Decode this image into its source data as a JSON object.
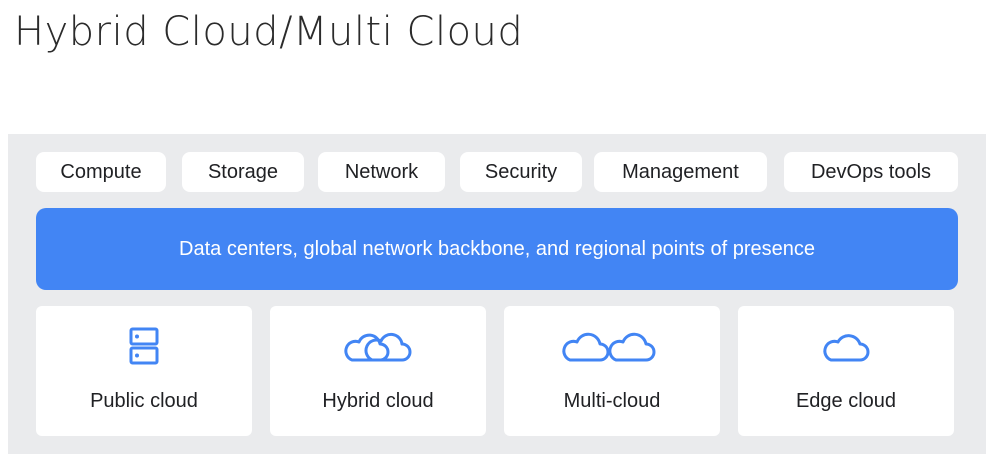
{
  "page": {
    "title": "Hybrid Cloud/Multi Cloud"
  },
  "services": [
    {
      "label": "Compute"
    },
    {
      "label": "Storage"
    },
    {
      "label": "Network"
    },
    {
      "label": "Security"
    },
    {
      "label": "Management"
    },
    {
      "label": "DevOps tools"
    }
  ],
  "infrastructure": {
    "label": "Data centers, global network backbone, and regional points of presence"
  },
  "deployment_models": [
    {
      "label": "Public cloud",
      "icon": "server-stack-icon"
    },
    {
      "label": "Hybrid cloud",
      "icon": "overlapping-clouds-icon"
    },
    {
      "label": "Multi-cloud",
      "icon": "two-clouds-icon"
    },
    {
      "label": "Edge cloud",
      "icon": "cloud-icon"
    }
  ],
  "colors": {
    "accent": "#4285f4",
    "panel_background": "#eaebed",
    "card_background": "#ffffff",
    "text": "#202124"
  }
}
